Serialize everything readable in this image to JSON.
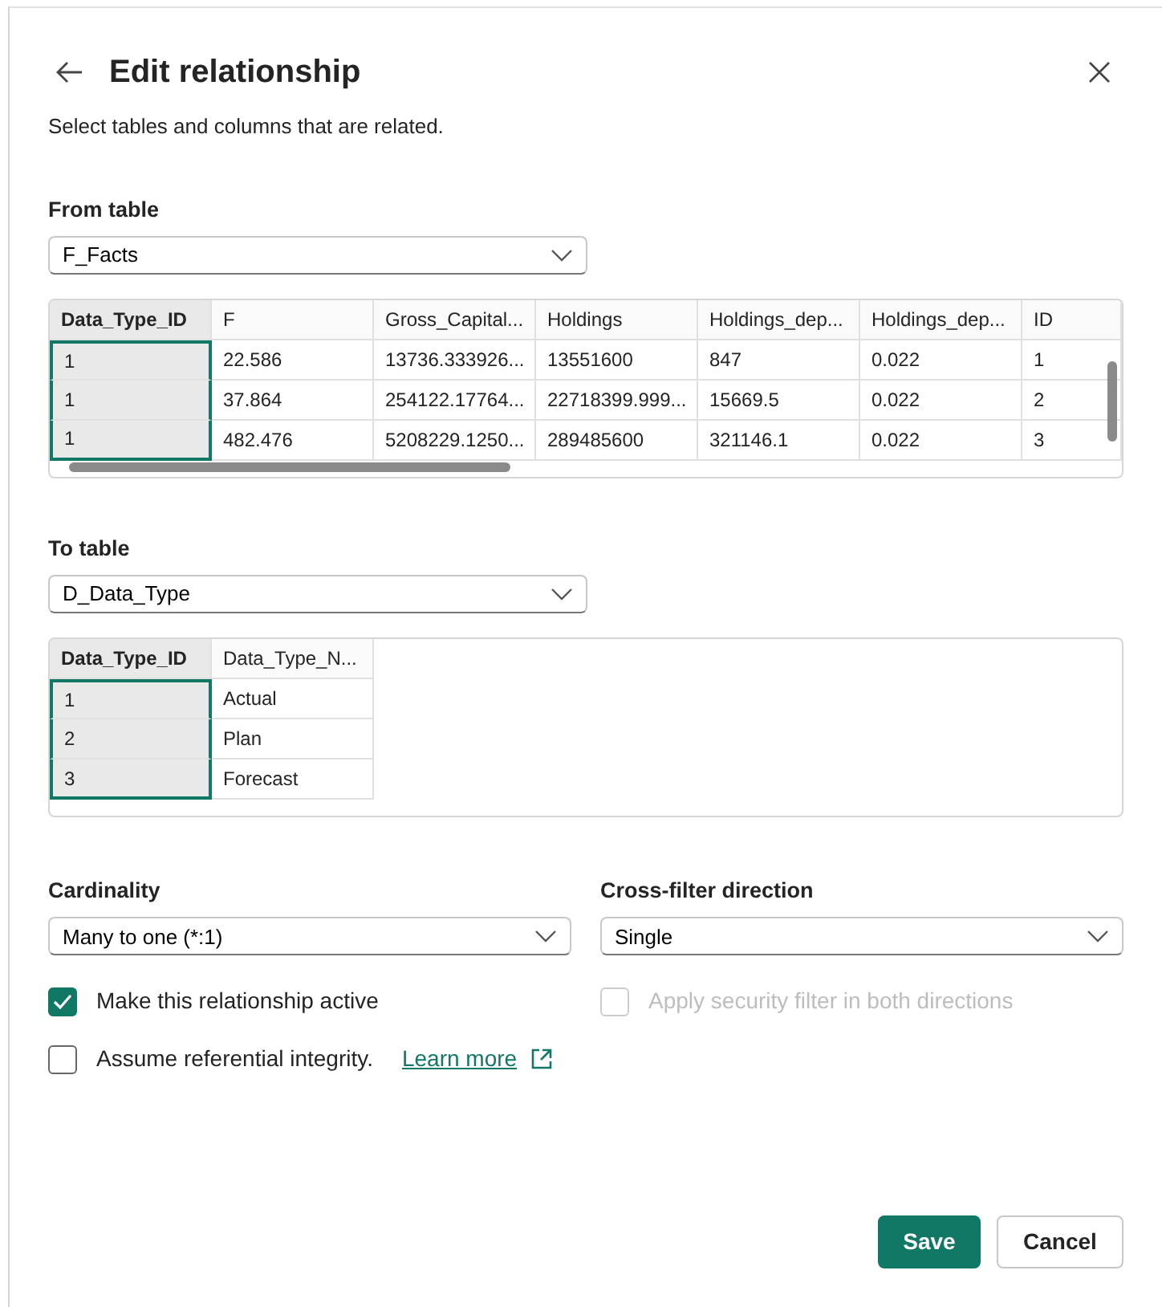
{
  "dialog": {
    "title": "Edit relationship",
    "subtitle": "Select tables and columns that are related."
  },
  "from_table": {
    "label": "From table",
    "value": "F_Facts",
    "grid": {
      "columns": [
        {
          "name": "Data_Type_ID",
          "selected": true
        },
        {
          "name": "F",
          "selected": false
        },
        {
          "name": "Gross_Capital...",
          "selected": false
        },
        {
          "name": "Holdings",
          "selected": false
        },
        {
          "name": "Holdings_dep...",
          "selected": false
        },
        {
          "name": "Holdings_dep...",
          "selected": false
        },
        {
          "name": "ID",
          "selected": false
        }
      ],
      "rows": [
        [
          "1",
          "22.586",
          "13736.333926...",
          "13551600",
          "847",
          "0.022",
          "1"
        ],
        [
          "1",
          "37.864",
          "254122.17764...",
          "22718399.999...",
          "15669.5",
          "0.022",
          "2"
        ],
        [
          "1",
          "482.476",
          "5208229.1250...",
          "289485600",
          "321146.1",
          "0.022",
          "3"
        ]
      ],
      "scrollbars": true
    }
  },
  "to_table": {
    "label": "To table",
    "value": "D_Data_Type",
    "grid": {
      "columns": [
        {
          "name": "Data_Type_ID",
          "selected": true
        },
        {
          "name": "Data_Type_N...",
          "selected": false
        }
      ],
      "rows": [
        [
          "1",
          "Actual"
        ],
        [
          "2",
          "Plan"
        ],
        [
          "3",
          "Forecast"
        ]
      ],
      "scrollbars": false
    }
  },
  "cardinality": {
    "label": "Cardinality",
    "value": "Many to one (*:1)"
  },
  "cross_filter": {
    "label": "Cross-filter direction",
    "value": "Single"
  },
  "options": [
    {
      "label": "Make this relationship active",
      "checked": true,
      "disabled": false
    },
    {
      "label": "Apply security filter in both directions",
      "checked": false,
      "disabled": true
    },
    {
      "label": "Assume referential integrity.",
      "checked": false,
      "disabled": false,
      "link": "Learn more"
    }
  ],
  "buttons": [
    {
      "label": "Save",
      "kind": "primary"
    },
    {
      "label": "Cancel",
      "kind": "secondary"
    }
  ]
}
